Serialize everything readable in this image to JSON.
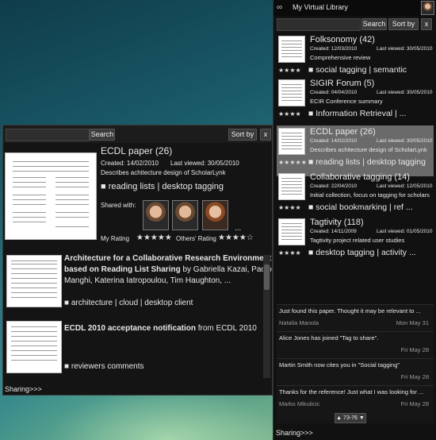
{
  "left": {
    "search_button": "Search",
    "sort_button": "Sort by",
    "close_button": "x",
    "detail": {
      "title": "ECDL paper (26)",
      "created": "Created: 14/02/2010",
      "last_viewed": "Last viewed: 30/05/2010",
      "description": "Describes achitecture design of ScholarLynk",
      "tags": "■ reading lists | desktop tagging",
      "shared_with_label": "Shared with:",
      "more": "...",
      "my_rating_label": "My Rating",
      "my_rating_stars": "★★★★★",
      "others_rating_label": "Others' Rating",
      "others_rating_stars": "★★★★☆"
    },
    "results": [
      {
        "title_bold": "Architecture for a Collaborative Research Environment based on Reading List Sharing",
        "title_rest_line1": "by Gabriella Kazai, Paolo",
        "line2_bold": "based on Reading List Sharing",
        "line3": "Manghi, Katerina  Iatropoulou, Tim Haughton, ...",
        "tags": "■ architecture | cloud | desktop client"
      },
      {
        "title_bold": "ECDL 2010 acceptance notification",
        "title_rest": "from ECDL 2010",
        "tags": "■ reviewers comments"
      }
    ],
    "sharing_label": "Sharing>>>"
  },
  "right": {
    "title": "My Virtual Library",
    "search_button": "Search",
    "sort_button": "Sort by",
    "close_button": "x",
    "items": [
      {
        "title": "Folksonomy (42)",
        "created": "Created: 12/03/2010",
        "viewed": "Last viewed: 30/05/2010",
        "desc": "Comprehensive review",
        "stars": "★★★★",
        "tags": "■ social tagging | semantic"
      },
      {
        "title": "SIGIR Forum (5)",
        "created": "Created: 04/04/2010",
        "viewed": "Last viewed: 30/05/2010",
        "desc": "ECIR Conference summary",
        "stars": "★★★★",
        "tags": "■ Information Retrieval | ..."
      },
      {
        "title": "ECDL paper (26)",
        "created": "Created: 14/02/2010",
        "viewed": "Last viewed: 30/05/2010",
        "desc": "Describes achitecture design of ScholarLynk",
        "stars": "★★★★★",
        "tags": "■ reading lists | desktop tagging"
      },
      {
        "title": "Collaborative tagging (14)",
        "created": "Created: 22/04/2010",
        "viewed": "Last viewed: 12/05/2010",
        "desc": "Initial collection, focus on tagging for scholars",
        "stars": "★★★★",
        "tags": "■ social bookmarking | ref ..."
      },
      {
        "title": "Tagtivity (118)",
        "created": "Created: 14/11/2009",
        "viewed": "Last viewed: 01/05/2010",
        "desc": "Tagtivity project related user studies",
        "stars": "★★★★",
        "tags": "■ desktop tagging | activity ..."
      }
    ],
    "messages": [
      {
        "text": "Just found this paper. Thought it may be relevant to ...",
        "who": "Natalia Manola",
        "when": "Mon May 31"
      },
      {
        "text": "Alice Jones has joined \"Tag to share\".",
        "who": "",
        "when": "Fri May 28"
      },
      {
        "text": "Martin Smith now cites you in \"Social tagging\"",
        "who": "",
        "when": "Fri May 28"
      },
      {
        "text": "Thanks for the reference! Just what I was looking for ...",
        "who": "Marko Mikulicic",
        "when": "Fri May 28"
      }
    ],
    "pager": "▲ 73-76 ▼",
    "sharing_label": "Sharing>>>"
  },
  "colors": {
    "panel": "#141414",
    "selected": "#6a6a6a",
    "text": "#e8e8e8"
  }
}
